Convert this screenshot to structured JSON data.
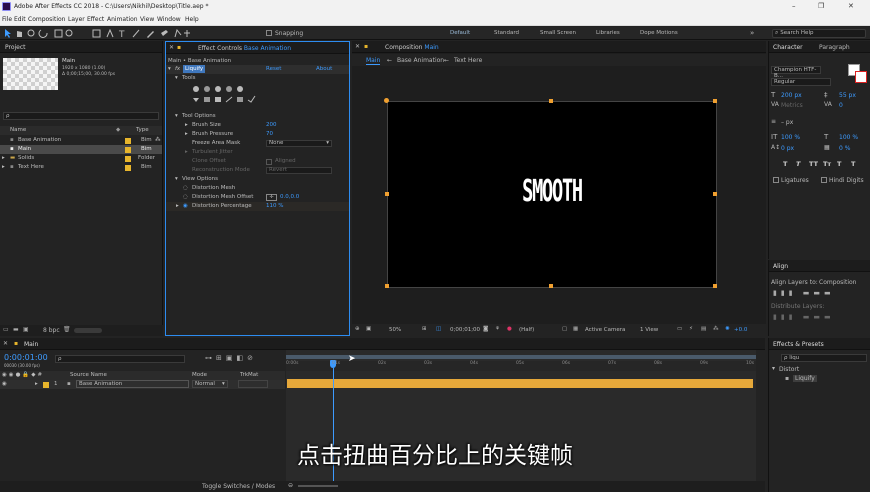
{
  "app": {
    "title": "Adobe After Effects CC 2018 - C:\\Users\\Nikhil\\Desktop\\Title.aep *",
    "menus": [
      "File",
      "Edit",
      "Composition",
      "Layer",
      "Effect",
      "Animation",
      "View",
      "Window",
      "Help"
    ],
    "window_controls": [
      "–",
      "❐",
      "✕"
    ]
  },
  "toolbar": {
    "snapping": "Snapping",
    "workspaces": [
      "Default",
      "Standard",
      "Small Screen",
      "Libraries",
      "Dope Motions"
    ],
    "menu_glyph": "»",
    "search": "Search Help"
  },
  "project": {
    "title": "Project",
    "preview_name": "Main",
    "preview_info1": "1920 x 1080 (1.00)",
    "preview_info2": "Δ 0;00;15;00, 30.00 fps",
    "search_placeholder": "ρ",
    "columns": {
      "name": "Name",
      "type": "Type"
    },
    "items": [
      {
        "name": "Base Animation",
        "type": "Bim"
      },
      {
        "name": "Main",
        "type": "Bim"
      },
      {
        "name": "Solids",
        "type": "Folder"
      },
      {
        "name": "Text Here",
        "type": "Bim"
      }
    ],
    "bpc": "8 bpc"
  },
  "effect_controls": {
    "title": "Effect Controls",
    "title_layer": "Base Animation",
    "subtitle": "Main • Base Animation",
    "fx": "fx",
    "effect_name": "Liquify",
    "reset": "Reset",
    "about": "About",
    "tools": "Tools",
    "tool_options": "Tool Options",
    "brush_size_label": "Brush Size",
    "brush_size": "200",
    "brush_pressure_label": "Brush Pressure",
    "brush_pressure": "70",
    "freeze_label": "Freeze Area Mask",
    "freeze_value": "None",
    "turbulent_label": "Turbulent Jitter",
    "clone_offset_label": "Clone Offset",
    "clone_offset_value": "Aligned",
    "reconstruction_label": "Reconstruction Mode",
    "reconstruction_value": "Revert",
    "view_options": "View Options",
    "distortion_mesh": "Distortion Mesh",
    "distortion_mesh_offset_label": "Distortion Mesh Offset",
    "distortion_mesh_offset": "0.0,0.0",
    "distortion_pct_label": "Distortion Percentage",
    "distortion_pct": "110 %"
  },
  "composition": {
    "title": "Composition",
    "title_name": "Main",
    "breadcrumb": [
      "Main",
      "Base Animation",
      "Text Here"
    ],
    "canvas_text": "SMOOTH",
    "zoom": "50%",
    "timecode": "0;00;01;00",
    "resolution": "(Half)",
    "camera": "Active Camera",
    "view": "1 View",
    "exposure": "+0.0"
  },
  "character": {
    "title": "Character",
    "paragraph": "Paragraph",
    "font": "Champion HTF-B...",
    "style": "Regular",
    "size": "200 px",
    "leading": "55 px",
    "kerning": "Metrics",
    "tracking": "0",
    "stroke": "– px",
    "vscale": "100 %",
    "hscale": "100 %",
    "baseline": "0 px",
    "tsume": "0 %",
    "ligatures": "Ligatures",
    "hindi": "Hindi Digits",
    "type_buttons": [
      "T",
      "T",
      "TT",
      "Tт",
      "T",
      "T"
    ]
  },
  "align": {
    "title": "Align",
    "align_to_label": "Align Layers to:",
    "align_to": "Composition",
    "distribute": "Distribute Layers:"
  },
  "effects_presets": {
    "title": "Effects & Presets",
    "search": "liqu",
    "category": "Distort",
    "item": "Liquify"
  },
  "timeline": {
    "tab": "Main",
    "timecode": "0:00:01:00",
    "timecode_sub": "00030 (30.00 fps)",
    "columns": {
      "source": "Source Name",
      "mode": "Mode",
      "trkmat": "TrkMat"
    },
    "layer_index": "1",
    "layer_name": "Base Animation",
    "layer_mode": "Normal",
    "ticks": [
      "0:00s",
      "01s",
      "02s",
      "03s",
      "04s",
      "05s",
      "06s",
      "07s",
      "08s",
      "09s",
      "10s"
    ],
    "toggle": "Toggle Switches / Modes",
    "playhead_fraction": 0.1
  },
  "subtitle": "点击扭曲百分比上的关键帧"
}
